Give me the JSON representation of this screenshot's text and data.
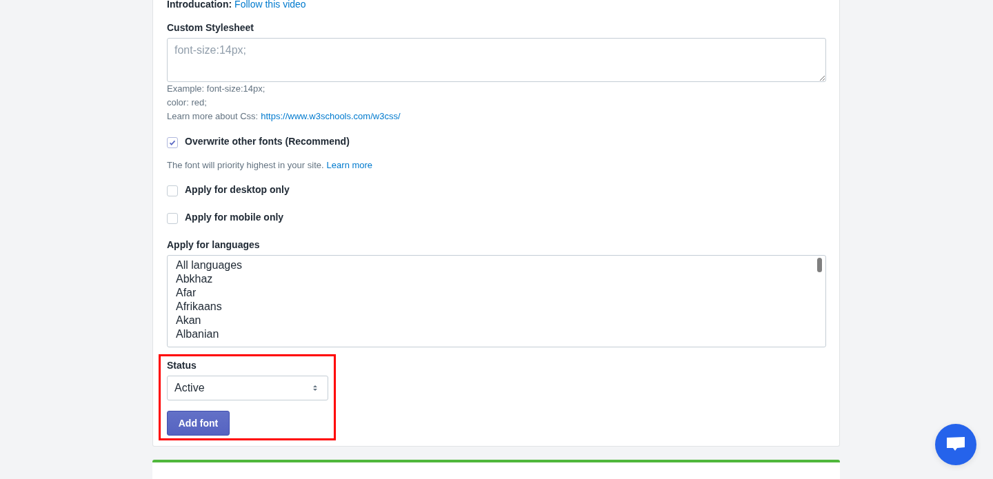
{
  "intro": {
    "label": "Introducation:",
    "link": "Follow this video"
  },
  "stylesheet": {
    "label": "Custom Stylesheet",
    "placeholder": "font-size:14px;",
    "help": [
      "Example: font-size:14px;",
      "color: red;"
    ],
    "learn_prefix": "Learn more about Css:",
    "learn_link": "https://www.w3schools.com/w3css/"
  },
  "overwrite": {
    "label": "Overwrite other fonts (Recommend)",
    "checked": true,
    "note": "The font will priority highest in your site.",
    "note_link": "Learn more"
  },
  "options": [
    {
      "label": "Apply for desktop only",
      "checked": false
    },
    {
      "label": "Apply for mobile only",
      "checked": false
    }
  ],
  "languages": {
    "label": "Apply for languages",
    "items": [
      "All languages",
      "Abkhaz",
      "Afar",
      "Afrikaans",
      "Akan",
      "Albanian"
    ]
  },
  "status": {
    "label": "Status",
    "value": "Active"
  },
  "submit": "Add font"
}
